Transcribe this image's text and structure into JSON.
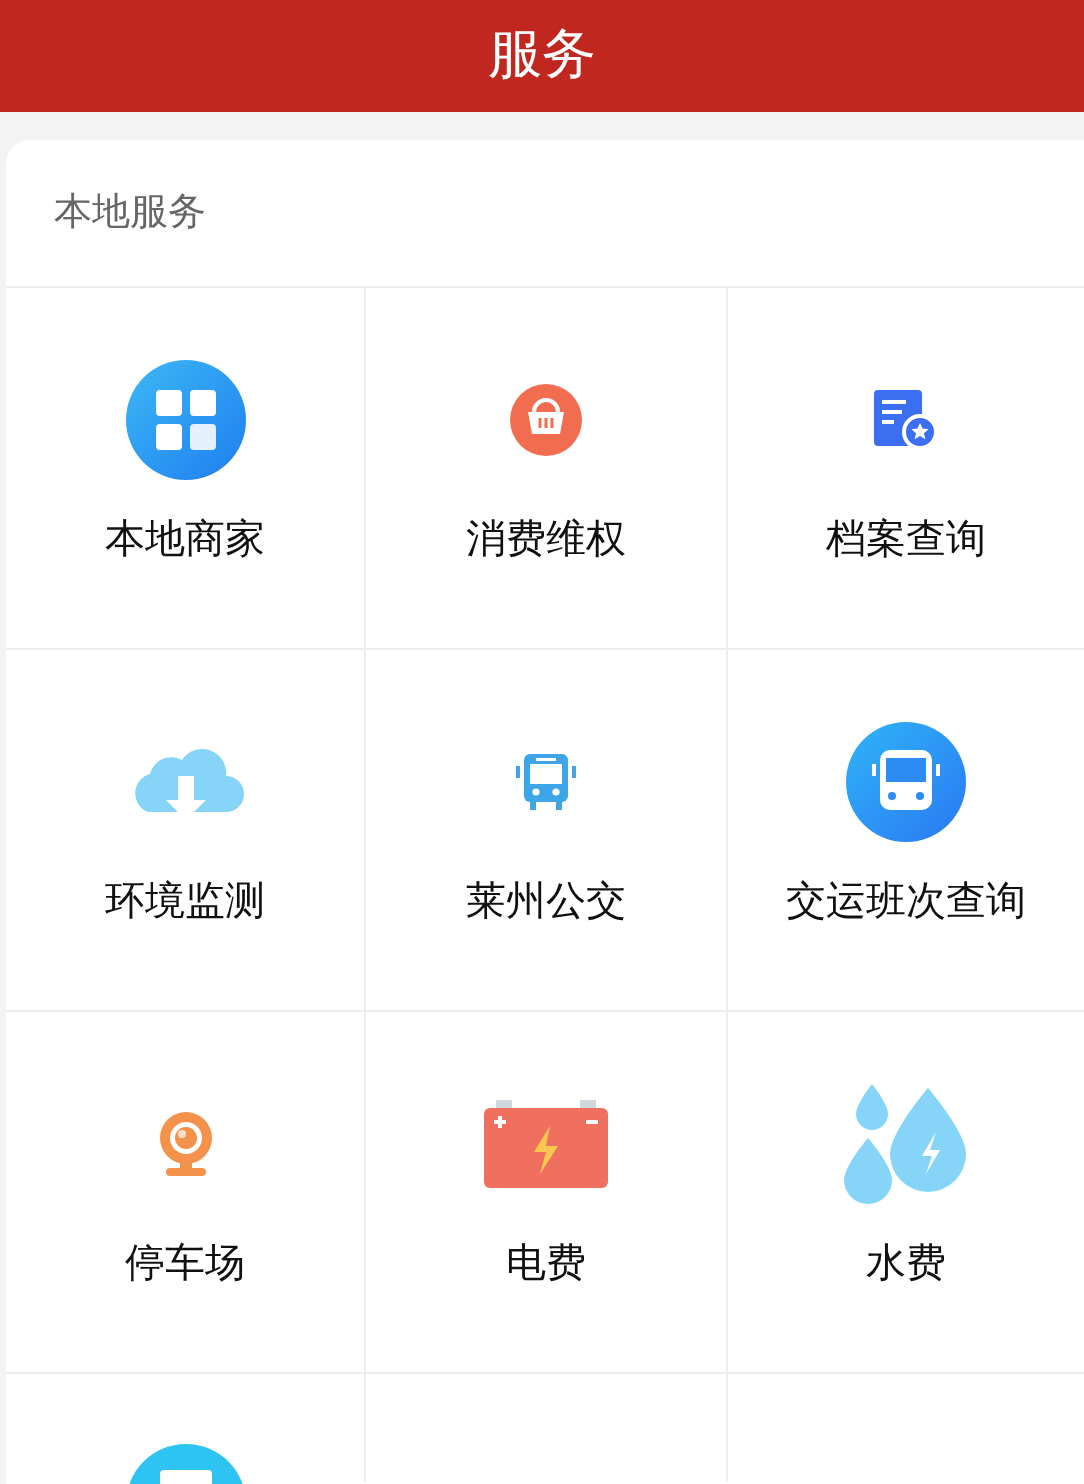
{
  "header": {
    "title": "服务"
  },
  "section": {
    "title": "本地服务",
    "items": [
      {
        "label": "本地商家"
      },
      {
        "label": "消费维权"
      },
      {
        "label": "档案查询"
      },
      {
        "label": "环境监测"
      },
      {
        "label": "莱州公交"
      },
      {
        "label": "交运班次查询"
      },
      {
        "label": "停车场"
      },
      {
        "label": "电费"
      },
      {
        "label": "水费"
      },
      {
        "kind": "partial"
      }
    ]
  }
}
